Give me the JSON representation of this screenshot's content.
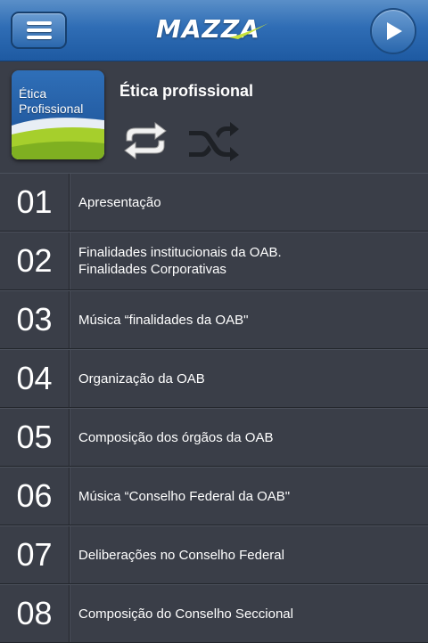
{
  "header": {
    "logo_text": "MAZZA",
    "menu_icon": "hamburger-menu-icon",
    "play_icon": "play-icon"
  },
  "album": {
    "cover_text_line1": "Ética",
    "cover_text_line2": "Profissional",
    "title": "Ética profissional",
    "repeat_icon": "repeat-icon",
    "shuffle_icon": "shuffle-icon"
  },
  "tracks": [
    {
      "number": "01",
      "title": "Apresentação"
    },
    {
      "number": "02",
      "title_line1": "Finalidades institucionais da OAB.",
      "title_line2": "Finalidades Corporativas"
    },
    {
      "number": "03",
      "title": "Música “finalidades da OAB\""
    },
    {
      "number": "04",
      "title": "Organização da OAB"
    },
    {
      "number": "05",
      "title": "Composição dos órgãos da OAB"
    },
    {
      "number": "06",
      "title": "Música “Conselho Federal da OAB\""
    },
    {
      "number": "07",
      "title": "Deliberações no Conselho Federal"
    },
    {
      "number": "08",
      "title": "Composição do Conselho Seccional"
    }
  ],
  "colors": {
    "topbar": "#2f6db5",
    "background": "#3a3e48",
    "logo_accent": "#c8e23a",
    "text": "#ffffff"
  }
}
